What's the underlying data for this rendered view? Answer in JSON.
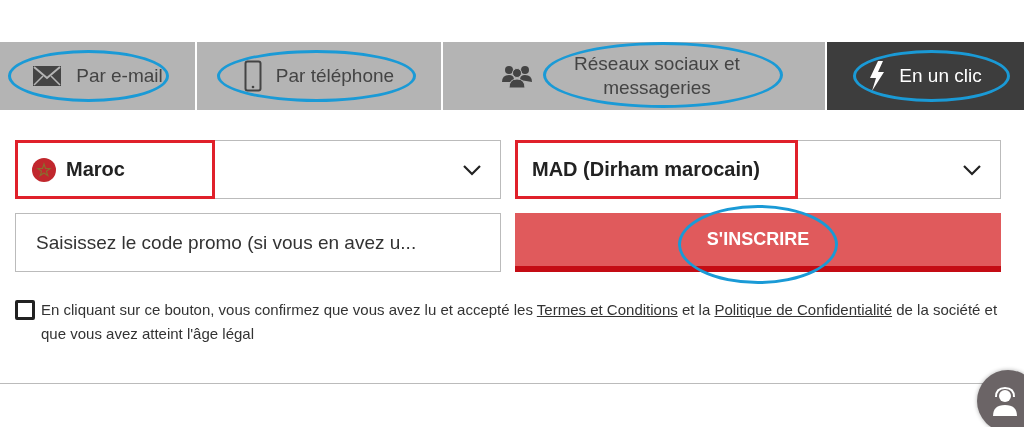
{
  "tabs": [
    {
      "label": "Par e-mail",
      "selected": false,
      "highlighted": true
    },
    {
      "label": "Par téléphone",
      "selected": false,
      "highlighted": true
    },
    {
      "label": "Réseaux sociaux et messageries",
      "selected": false,
      "highlighted": true
    },
    {
      "label": "En un clic",
      "selected": true,
      "highlighted": true
    }
  ],
  "country_select": {
    "value": "Maroc",
    "highlighted": true
  },
  "currency_select": {
    "value": "MAD (Dirham marocain)",
    "highlighted": true
  },
  "promo_field": {
    "placeholder": "Saisissez le code promo (si vous en avez u..."
  },
  "signup_button": {
    "label": "S'INSCRIRE",
    "highlighted": true
  },
  "consent": {
    "checked": false,
    "parts": [
      {
        "kind": "text",
        "text": "En cliquant sur ce bouton, vous confirmez que vous avez lu et accepté les "
      },
      {
        "kind": "link",
        "text": "Termes et Conditions"
      },
      {
        "kind": "text",
        "text": " et la "
      },
      {
        "kind": "link",
        "text": "Politique de Confidentialité"
      },
      {
        "kind": "text",
        "text": " de la société et que vous avez atteint l'âge légal"
      }
    ]
  }
}
